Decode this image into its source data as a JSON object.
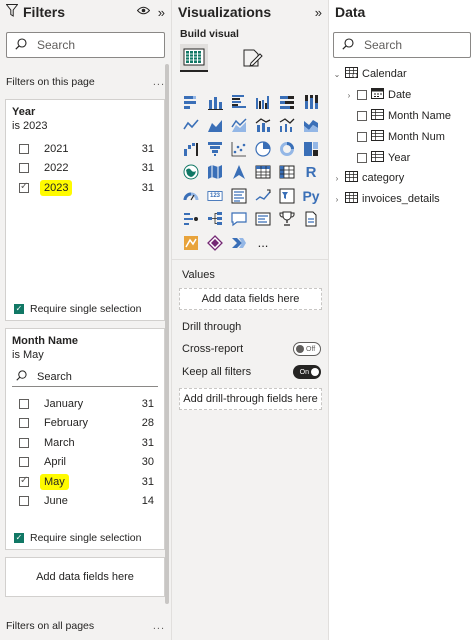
{
  "filters": {
    "title": "Filters",
    "search_placeholder": "Search",
    "on_this_page": "Filters on this page",
    "on_all_pages": "Filters on all pages",
    "more": "...",
    "year_card": {
      "title": "Year",
      "subtitle": "is 2023",
      "options": [
        {
          "label": "2021",
          "count": "31",
          "checked": false
        },
        {
          "label": "2022",
          "count": "31",
          "checked": false
        },
        {
          "label": "2023",
          "count": "31",
          "checked": true
        }
      ],
      "require_single": "Require single selection"
    },
    "month_card": {
      "title": "Month Name",
      "subtitle": "is May",
      "search_placeholder": "Search",
      "options": [
        {
          "label": "January",
          "count": "31",
          "checked": false
        },
        {
          "label": "February",
          "count": "28",
          "checked": false
        },
        {
          "label": "March",
          "count": "31",
          "checked": false
        },
        {
          "label": "April",
          "count": "30",
          "checked": false
        },
        {
          "label": "May",
          "count": "31",
          "checked": true
        },
        {
          "label": "June",
          "count": "14",
          "checked": false
        }
      ],
      "require_single": "Require single selection"
    },
    "add_fields": "Add data fields here",
    "highlight_color": "#fffb00",
    "accent_color": "#117865"
  },
  "visualizations": {
    "title": "Visualizations",
    "build_visual": "Build visual",
    "values_label": "Values",
    "values_placeholder": "Add data fields here",
    "drill_through": "Drill through",
    "cross_report": "Cross-report",
    "cross_report_state": "Off",
    "keep_filters": "Keep all filters",
    "keep_filters_state": "On",
    "drill_placeholder": "Add drill-through fields here",
    "r_label": "R",
    "py_label": "Py",
    "num_label": "123",
    "more_label": "..."
  },
  "data_pane": {
    "title": "Data",
    "search_placeholder": "Search",
    "tree": [
      {
        "label": "Calendar",
        "level": 0,
        "expanded": true,
        "type": "table"
      },
      {
        "label": "Date",
        "level": 1,
        "expanded": false,
        "type": "hierarchy"
      },
      {
        "label": "Month Name",
        "level": 1,
        "type": "field"
      },
      {
        "label": "Month Num",
        "level": 1,
        "type": "field"
      },
      {
        "label": "Year",
        "level": 1,
        "type": "field"
      },
      {
        "label": "category",
        "level": 0,
        "expanded": false,
        "type": "table"
      },
      {
        "label": "invoices_details",
        "level": 0,
        "expanded": false,
        "type": "table"
      }
    ]
  }
}
